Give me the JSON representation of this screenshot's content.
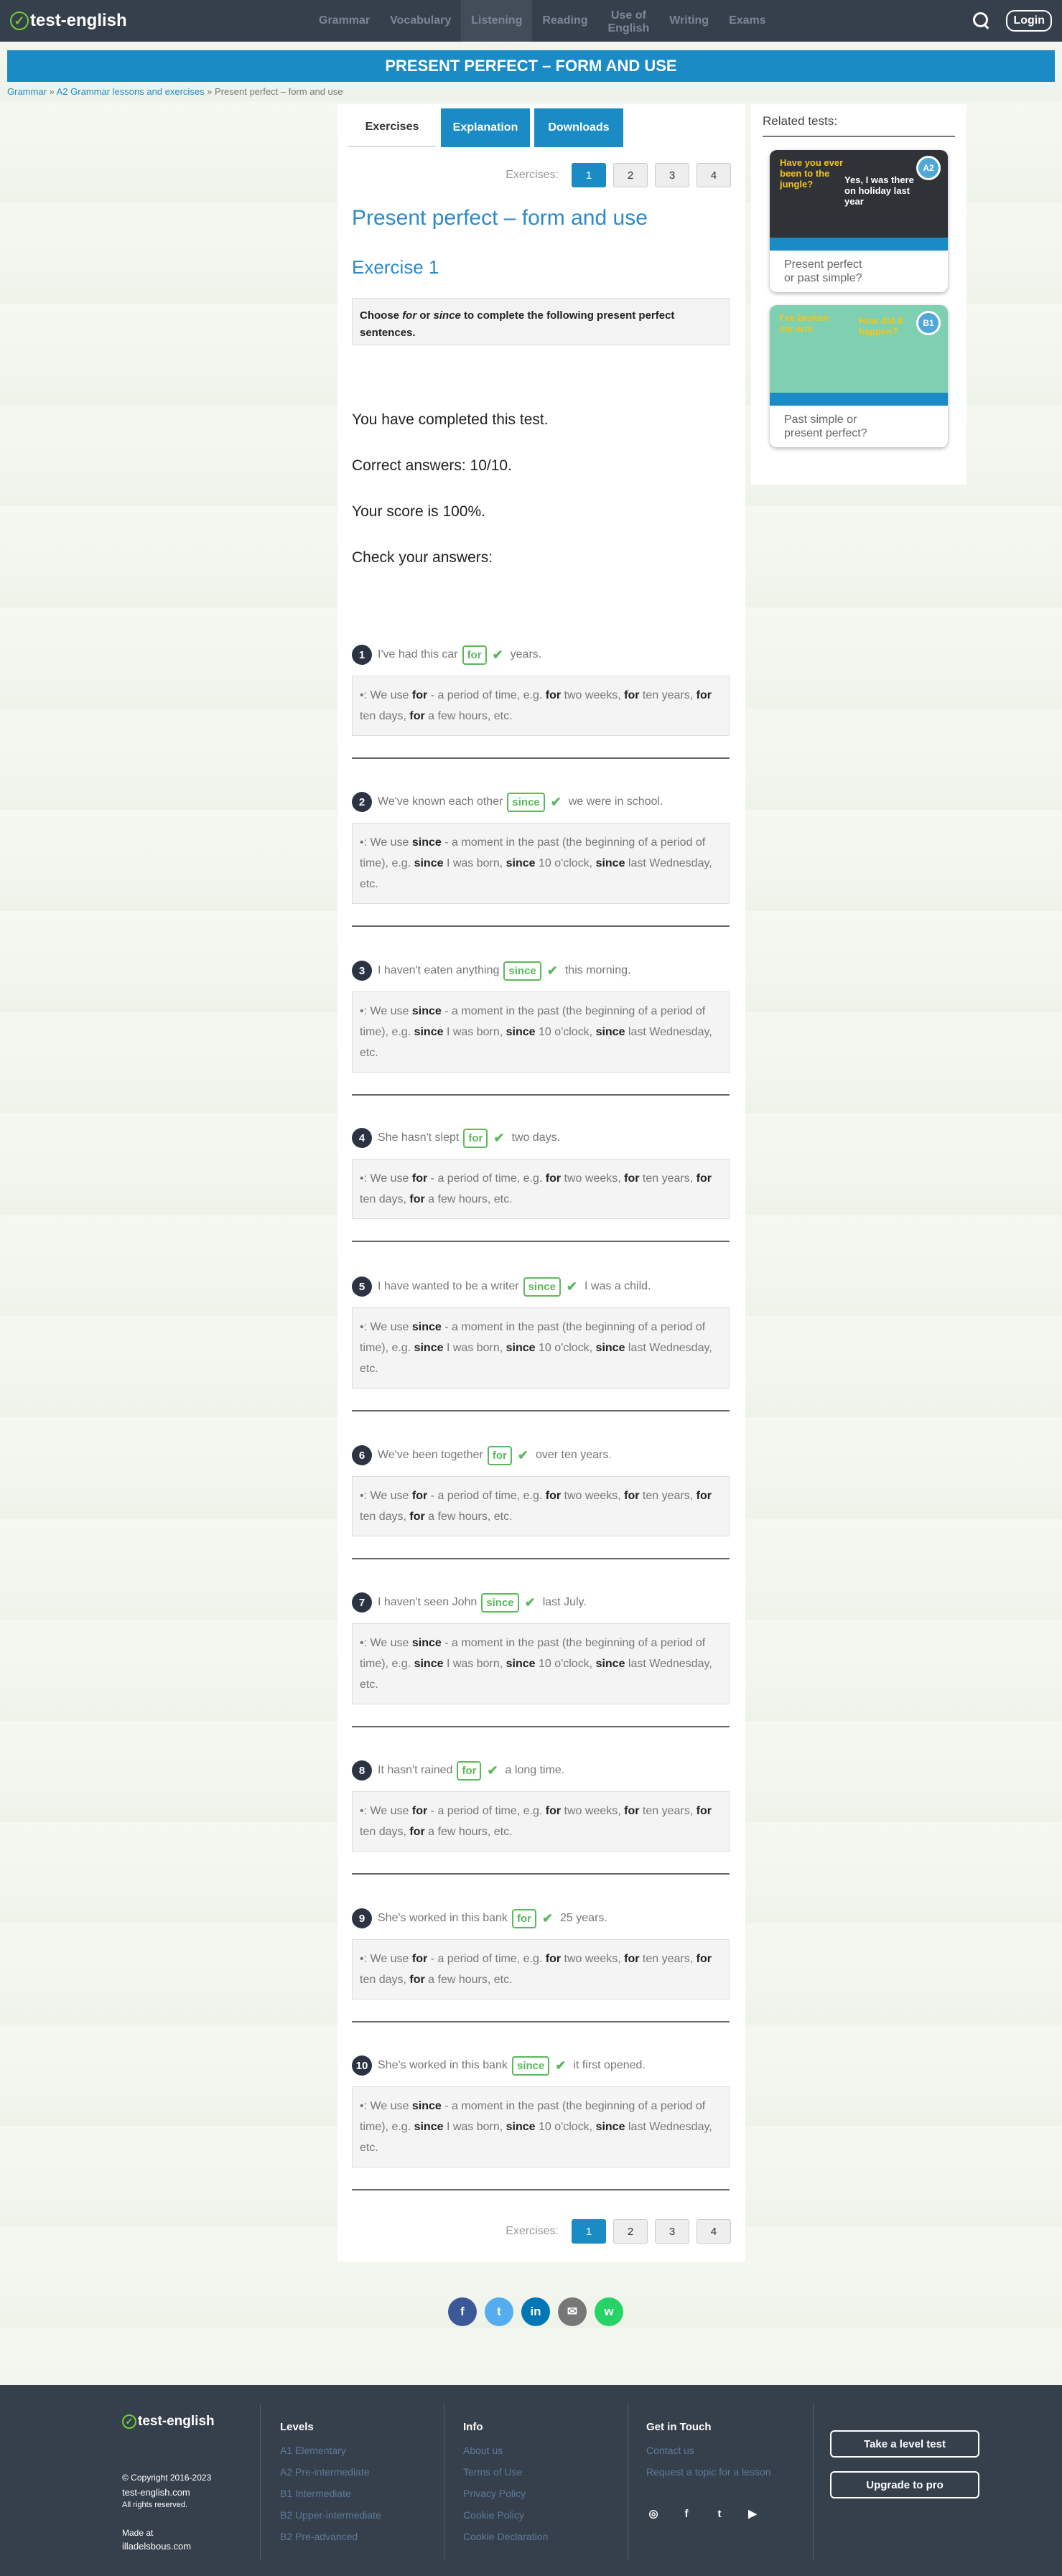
{
  "header": {
    "logo_text": "test-english",
    "nav": [
      "Grammar",
      "Vocabulary",
      "Listening",
      "Reading",
      "Use of",
      "English",
      "Writing",
      "Exams"
    ],
    "login": "Login"
  },
  "page_title": "PRESENT PERFECT – FORM AND USE",
  "breadcrumb": {
    "a": "Grammar",
    "sep1": " » ",
    "b": "A2 Grammar lessons and exercises",
    "sep2": " » ",
    "c": "Present perfect – form and use"
  },
  "tabs": [
    "Exercises",
    "Explanation",
    "Downloads"
  ],
  "pager": {
    "label": "Exercises:",
    "pages": [
      "1",
      "2",
      "3",
      "4"
    ]
  },
  "heading": "Present perfect – form and use",
  "exercise_title": "Exercise 1",
  "instruction": {
    "a": "Choose ",
    "b": "for",
    "c": " or ",
    "d": "since",
    "e": " to complete the following present perfect sentences."
  },
  "results": {
    "completed": "You have completed this test.",
    "correct": "Correct answers: 10/10.",
    "score": "Your score is 100%.",
    "check": "Check your answers:"
  },
  "explanations": {
    "for": {
      "w1": "for",
      "t1": " - a period of time, e.g. ",
      "w2": "for",
      "t2": " two weeks, ",
      "w3": "for",
      "t3": " ten years, ",
      "w4": "for",
      "t4": " ten days, ",
      "w5": "for",
      "t5": " a few hours, etc."
    },
    "since": {
      "w1": "since",
      "t1": " - a moment in the past (the beginning of a period of time), e.g. ",
      "w2": "since",
      "t2": " I was born, ",
      "w3": "since",
      "t3": " 10 o'clock, ",
      "w4": "since",
      "t4": " last Wednesday, etc."
    }
  },
  "expl_prefix": "We use ",
  "questions": [
    {
      "n": "1",
      "before": "I've had this car",
      "answer": "for",
      "after": "years."
    },
    {
      "n": "2",
      "before": "We've known each other",
      "answer": "since",
      "after": "we were in school."
    },
    {
      "n": "3",
      "before": "I haven't eaten anything",
      "answer": "since",
      "after": "this morning."
    },
    {
      "n": "4",
      "before": "She hasn't slept",
      "answer": "for",
      "after": "two days."
    },
    {
      "n": "5",
      "before": "I have wanted to be a writer",
      "answer": "since",
      "after": "I was a child."
    },
    {
      "n": "6",
      "before": "We've been together",
      "answer": "for",
      "after": "over ten years."
    },
    {
      "n": "7",
      "before": "I haven't seen John",
      "answer": "since",
      "after": "last July."
    },
    {
      "n": "8",
      "before": "It hasn't rained",
      "answer": "for",
      "after": "a long time."
    },
    {
      "n": "9",
      "before": "She's worked in this bank",
      "answer": "for",
      "after": "25 years."
    },
    {
      "n": "10",
      "before": "She's worked in this bank",
      "answer": "since",
      "after": "it first opened."
    }
  ],
  "sidebar": {
    "title": "Related tests:",
    "cards": [
      {
        "label1": "Present perfect",
        "label2": "or past simple?",
        "img_text_a": "Have you ever been to the jungle?",
        "img_text_b": "Yes, I was there on holiday last year",
        "badge": "A2"
      },
      {
        "label1": "Past simple or",
        "label2": "present perfect?",
        "img_text_a": "I've broken my arm",
        "img_text_b": "How did it happen?",
        "badge": "B1"
      }
    ]
  },
  "social": [
    "f",
    "t",
    "in",
    "✉",
    "w"
  ],
  "footer": {
    "logo": "test-english",
    "copyright": "© Copyright 2016-2023",
    "site": "test-english.com",
    "rights": "All rights reserved.",
    "made_at": "Made at",
    "maker": "illadelsbous.com",
    "levels_title": "Levels",
    "levels": [
      "A1 Elementary",
      "A2 Pre-intermediate",
      "B1 Intermediate",
      "B2 Upper-intermediate",
      "B2 Pre-advanced"
    ],
    "info_title": "Info",
    "info": [
      "About us",
      "Terms of Use",
      "Privacy Policy",
      "Cookie Policy",
      "Cookie Declaration"
    ],
    "touch_title": "Get in Touch",
    "touch": [
      "Contact us",
      "Request a topic for a lesson"
    ],
    "btn_level": "Take a level test",
    "btn_pro": "Upgrade to pro"
  },
  "colors": {
    "accent": "#1b8bc6",
    "header": "#363f4c",
    "correct": "#5cb85c"
  }
}
